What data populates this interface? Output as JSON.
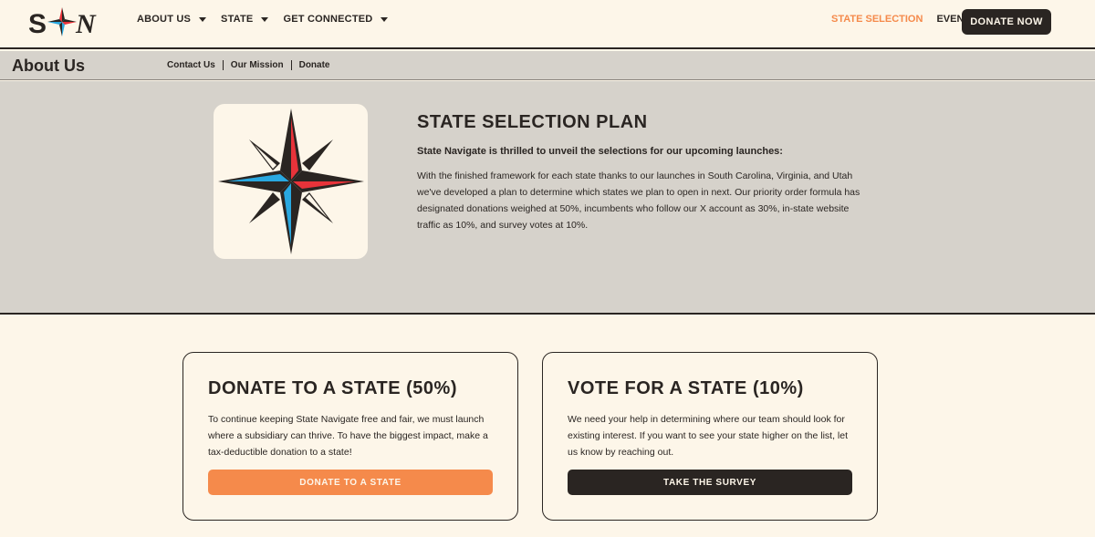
{
  "header": {
    "logo_alt": "S★N",
    "nav": [
      {
        "label": "ABOUT US"
      },
      {
        "label": "STATE"
      },
      {
        "label": "GET CONNECTED"
      }
    ],
    "state_selection": "STATE SELECTION",
    "events": "EVENTS",
    "donate_now": "DONATE NOW"
  },
  "subnav": {
    "title": "About Us",
    "links": [
      "Contact Us",
      "Our Mission",
      "Donate"
    ]
  },
  "hero": {
    "title": "STATE SELECTION PLAN",
    "subtitle": "State Navigate is thrilled to unveil the selections for our upcoming launches:",
    "body": "With the finished framework for each state thanks to our launches in South Carolina, Virginia, and Utah we've developed a plan to determine which states we plan to open in next. Our priority order formula has designated donations weighed at 50%, incumbents who follow our X account as 30%, in-state website traffic as 10%, and survey votes at 10%."
  },
  "cards": [
    {
      "title": "DONATE TO A STATE (50%)",
      "body": "To continue keeping State Navigate free and fair, we must launch where a subsidiary can thrive. To have the biggest impact, make a tax-deductible donation to a state!",
      "button": "DONATE TO A STATE"
    },
    {
      "title": "VOTE FOR A STATE (10%)",
      "body": "We need your help in determining where our team should look for existing interest. If you want to see your state higher on the list, let us know by reaching out.",
      "button": "TAKE THE SURVEY"
    }
  ],
  "colors": {
    "cream": "#fdf6e9",
    "gray": "#d6d2cb",
    "dark": "#2a2522",
    "accent": "#f58a4b",
    "red": "#e8333a",
    "blue": "#29a8e0"
  },
  "icons": [
    "compass-star-logo",
    "chevron-down-icon"
  ]
}
